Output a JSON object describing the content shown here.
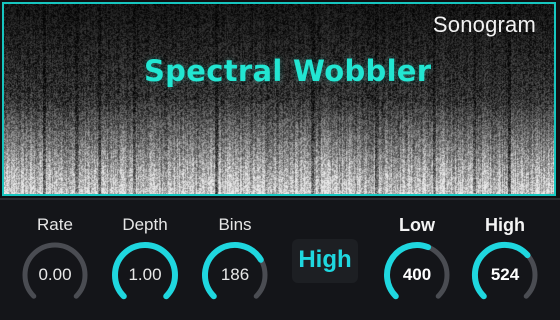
{
  "sonogram": {
    "label": "Sonogram",
    "title": "Spectral Wobbler"
  },
  "colors": {
    "accent": "#1fd7df",
    "title": "#22e6d2",
    "track": "#4a4c52",
    "panel": "#141519"
  },
  "knobs": [
    {
      "id": "rate",
      "label": "Rate",
      "value": "0.00",
      "level": 0.0,
      "bold": false
    },
    {
      "id": "depth",
      "label": "Depth",
      "value": "1.00",
      "level": 1.0,
      "bold": false
    },
    {
      "id": "bins",
      "label": "Bins",
      "value": "186",
      "level": 0.72,
      "bold": false
    },
    {
      "id": "low",
      "label": "Low",
      "value": "400",
      "level": 0.58,
      "bold": true
    },
    {
      "id": "high",
      "label": "High",
      "value": "524",
      "level": 0.68,
      "bold": true
    }
  ],
  "mode_button": {
    "label": "High"
  }
}
